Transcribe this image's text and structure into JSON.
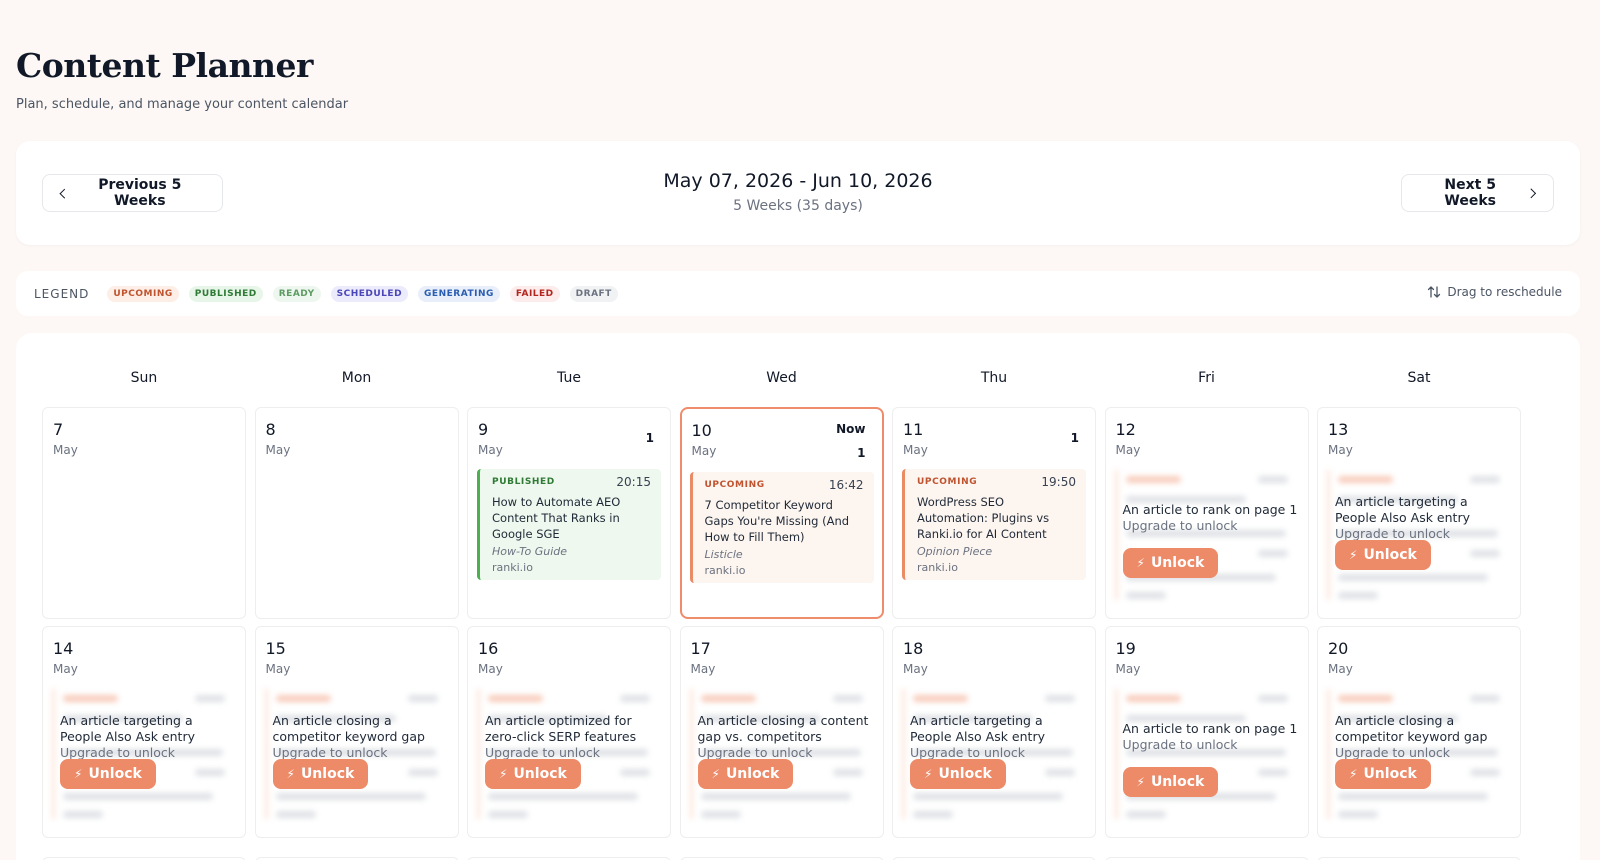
{
  "header": {
    "title": "Content Planner",
    "subtitle": "Plan, schedule, and manage your content calendar"
  },
  "nav": {
    "prev_label": "Previous 5 Weeks",
    "next_label": "Next 5 Weeks",
    "range": "May 07, 2026 - Jun 10, 2026",
    "range_sub": "5 Weeks (35 days)"
  },
  "legend": {
    "label": "LEGEND",
    "items": [
      {
        "label": "UPCOMING",
        "color": "#c0532f",
        "bg": "#fdeee7"
      },
      {
        "label": "PUBLISHED",
        "color": "#2f7a35",
        "bg": "#e8f5e9"
      },
      {
        "label": "READY",
        "color": "#5e9b63",
        "bg": "#eef7ef"
      },
      {
        "label": "SCHEDULED",
        "color": "#4b46b8",
        "bg": "#ecebfb"
      },
      {
        "label": "GENERATING",
        "color": "#2a5db0",
        "bg": "#e8effb"
      },
      {
        "label": "FAILED",
        "color": "#b3261e",
        "bg": "#fdecec"
      },
      {
        "label": "DRAFT",
        "color": "#6b7280",
        "bg": "#f1f2f4"
      }
    ],
    "drag_hint": "Drag to reschedule"
  },
  "weekdays": [
    "Sun",
    "Mon",
    "Tue",
    "Wed",
    "Thu",
    "Fri",
    "Sat"
  ],
  "week1": [
    {
      "day": "7",
      "month": "May"
    },
    {
      "day": "8",
      "month": "May"
    },
    {
      "day": "9",
      "month": "May",
      "count": "1",
      "event": {
        "status": "PUBLISHED",
        "time": "20:15",
        "title": "How to Automate AEO Content That Ranks in Google SGE",
        "type": "How-To Guide",
        "site": "ranki.io"
      }
    },
    {
      "day": "10",
      "month": "May",
      "count": "1",
      "now": "Now",
      "event": {
        "status": "UPCOMING",
        "time": "16:42",
        "title": "7 Competitor Keyword Gaps You're Missing (And How to Fill Them)",
        "type": "Listicle",
        "site": "ranki.io"
      }
    },
    {
      "day": "11",
      "month": "May",
      "count": "1",
      "event": {
        "status": "UPCOMING",
        "time": "19:50",
        "title": "WordPress SEO Automation: Plugins vs Ranki.io for AI Content",
        "type": "Opinion Piece",
        "site": "ranki.io"
      }
    },
    {
      "day": "12",
      "month": "May",
      "locked": {
        "text": "An article to rank on page 1",
        "sub": "Upgrade to unlock",
        "button": "Unlock"
      }
    },
    {
      "day": "13",
      "month": "May",
      "locked": {
        "text": "An article targeting a People Also Ask entry",
        "sub": "Upgrade to unlock",
        "button": "Unlock"
      }
    }
  ],
  "week2": [
    {
      "day": "14",
      "month": "May",
      "locked": {
        "text": "An article targeting a People Also Ask entry",
        "sub": "Upgrade to unlock",
        "button": "Unlock"
      }
    },
    {
      "day": "15",
      "month": "May",
      "locked": {
        "text": "An article closing a competitor keyword gap",
        "sub": "Upgrade to unlock",
        "button": "Unlock"
      }
    },
    {
      "day": "16",
      "month": "May",
      "locked": {
        "text": "An article optimized for zero-click SERP features",
        "sub": "Upgrade to unlock",
        "button": "Unlock"
      }
    },
    {
      "day": "17",
      "month": "May",
      "locked": {
        "text": "An article closing a content gap vs. competitors",
        "sub": "Upgrade to unlock",
        "button": "Unlock"
      }
    },
    {
      "day": "18",
      "month": "May",
      "locked": {
        "text": "An article targeting a People Also Ask entry",
        "sub": "Upgrade to unlock",
        "button": "Unlock"
      }
    },
    {
      "day": "19",
      "month": "May",
      "locked": {
        "text": "An article to rank on page 1",
        "sub": "Upgrade to unlock",
        "button": "Unlock"
      }
    },
    {
      "day": "20",
      "month": "May",
      "locked": {
        "text": "An article closing a competitor keyword gap",
        "sub": "Upgrade to unlock",
        "button": "Unlock"
      }
    }
  ]
}
